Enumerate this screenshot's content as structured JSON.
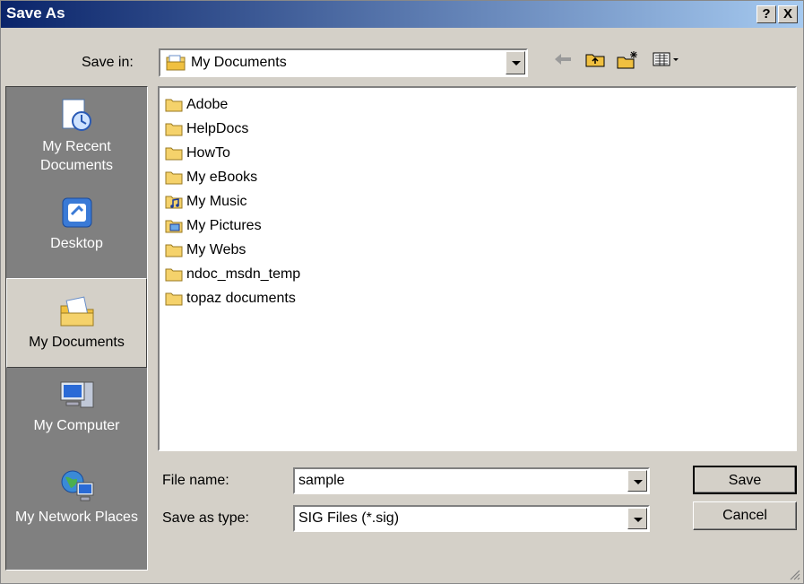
{
  "window": {
    "title": "Save As",
    "help_glyph": "?",
    "close_glyph": "X"
  },
  "save_in": {
    "label": "Save in:",
    "value": "My Documents"
  },
  "toolbar": [
    "back-arrow-icon",
    "up-folder-icon",
    "new-folder-icon",
    "view-menu-icon"
  ],
  "places": [
    {
      "label": "My Recent Documents",
      "icon": "recent-documents-icon"
    },
    {
      "label": "Desktop",
      "icon": "desktop-icon"
    },
    {
      "label": "My Documents",
      "icon": "my-documents-icon",
      "active": true
    },
    {
      "label": "My Computer",
      "icon": "my-computer-icon"
    },
    {
      "label": "My Network Places",
      "icon": "network-places-icon"
    }
  ],
  "files": [
    {
      "name": "Adobe",
      "icon": "folder-icon"
    },
    {
      "name": "HelpDocs",
      "icon": "folder-icon"
    },
    {
      "name": "HowTo",
      "icon": "folder-icon"
    },
    {
      "name": "My eBooks",
      "icon": "folder-icon"
    },
    {
      "name": "My Music",
      "icon": "music-folder-icon"
    },
    {
      "name": "My Pictures",
      "icon": "pictures-folder-icon"
    },
    {
      "name": "My Webs",
      "icon": "folder-icon"
    },
    {
      "name": "ndoc_msdn_temp",
      "icon": "folder-icon"
    },
    {
      "name": "topaz documents",
      "icon": "folder-icon"
    }
  ],
  "file_name": {
    "label": "File name:",
    "value": "sample"
  },
  "save_as_type": {
    "label": "Save as type:",
    "value": "SIG Files (*.sig)"
  },
  "buttons": {
    "save": "Save",
    "cancel": "Cancel"
  }
}
